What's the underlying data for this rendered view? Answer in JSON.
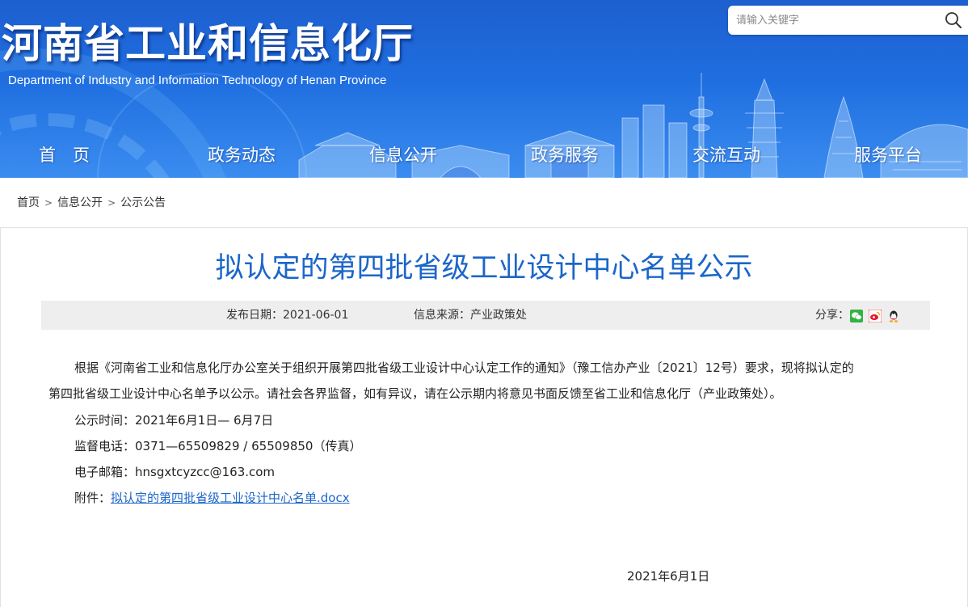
{
  "header": {
    "title": "河南省工业和信息化厅",
    "subtitle": "Department of Industry and Information Technology of Henan Province",
    "search_placeholder": "请输入关键字"
  },
  "nav": {
    "items": [
      "首　页",
      "政务动态",
      "信息公开",
      "政务服务",
      "交流互动",
      "服务平台"
    ]
  },
  "breadcrumb": {
    "items": [
      "首页",
      "信息公开",
      "公示公告"
    ],
    "separator": ">"
  },
  "article": {
    "title": "拟认定的第四批省级工业设计中心名单公示",
    "publish_date": "发布日期：2021-06-01",
    "source": "信息来源：产业政策处",
    "share_label": "分享：",
    "share_icons": [
      "wechat-icon",
      "weibo-icon",
      "qq-icon"
    ],
    "body_line1": "根据《河南省工业和信息化厅办公室关于组织开展第四批省级工业设计中心认定工作的通知》（豫工信办产业〔2021〕12号）要求，现将拟认定的",
    "body_line2": "第四批省级工业设计中心名单予以公示。请社会各界监督，如有异议，请在公示期内将意见书面反馈至省工业和信息化厅（产业政策处）。",
    "period": "公示时间：2021年6月1日— 6月7日",
    "phone": "监督电话：0371—65509829 / 65509850（传真）",
    "email": "电子邮箱：hnsgxtcyzcc@163.com",
    "attachment_label": "附件：",
    "attachment_link": "拟认定的第四批省级工业设计中心名单.docx",
    "sign_date": "2021年6月1日"
  },
  "colors": {
    "header_blue": "#1f6ee0",
    "title_blue": "#1b66c9",
    "meta_bg": "#eeeeee"
  }
}
